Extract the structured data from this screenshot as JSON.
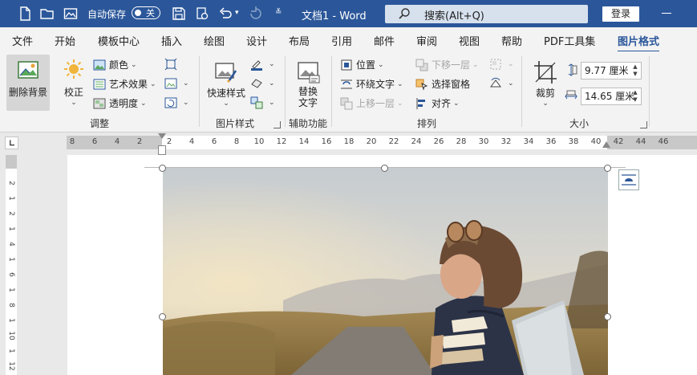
{
  "titlebar": {
    "autosave_label": "自动保存",
    "autosave_state": "关",
    "doc_title": "文档1  -  Word",
    "search_placeholder": "搜索(Alt+Q)",
    "login_label": "登录"
  },
  "tabs": [
    {
      "label": "文件"
    },
    {
      "label": "开始"
    },
    {
      "label": "模板中心"
    },
    {
      "label": "插入"
    },
    {
      "label": "绘图"
    },
    {
      "label": "设计"
    },
    {
      "label": "布局"
    },
    {
      "label": "引用"
    },
    {
      "label": "邮件"
    },
    {
      "label": "审阅"
    },
    {
      "label": "视图"
    },
    {
      "label": "帮助"
    },
    {
      "label": "PDF工具集"
    },
    {
      "label": "图片格式",
      "active": true
    }
  ],
  "ribbon": {
    "adjust": {
      "remove_bg": "删除背景",
      "corrections": "校正",
      "color": "颜色",
      "artistic": "艺术效果",
      "transparency": "透明度",
      "group_label": "调整"
    },
    "styles": {
      "quick_styles": "快速样式",
      "group_label": "图片样式"
    },
    "accessibility": {
      "alt_text_line1": "替换",
      "alt_text_line2": "文字",
      "group_label": "辅助功能"
    },
    "arrange": {
      "position": "位置",
      "wrap_text": "环绕文字",
      "bring_forward": "上移一层",
      "send_backward": "下移一层",
      "selection_pane": "选择窗格",
      "align": "对齐",
      "group_label": "排列"
    },
    "size": {
      "crop": "裁剪",
      "height": "9.77 厘米",
      "width": "14.65 厘米",
      "group_label": "大小"
    }
  },
  "ruler": {
    "h_ticks": [
      "8",
      "6",
      "4",
      "2",
      "2",
      "4",
      "6",
      "8",
      "10",
      "12",
      "14",
      "16",
      "18",
      "20",
      "22",
      "24",
      "26",
      "28",
      "30",
      "32",
      "34",
      "36",
      "38",
      "40",
      "42",
      "44",
      "46"
    ],
    "v_ticks": [
      "2",
      "1",
      "2",
      "1",
      "4",
      "1",
      "6",
      "1",
      "8",
      "1",
      "10",
      "1",
      "12"
    ]
  },
  "colors": {
    "title_bar": "#2b579a",
    "accent": "#2b579a",
    "ribbon_bg": "#f3f3f3"
  }
}
